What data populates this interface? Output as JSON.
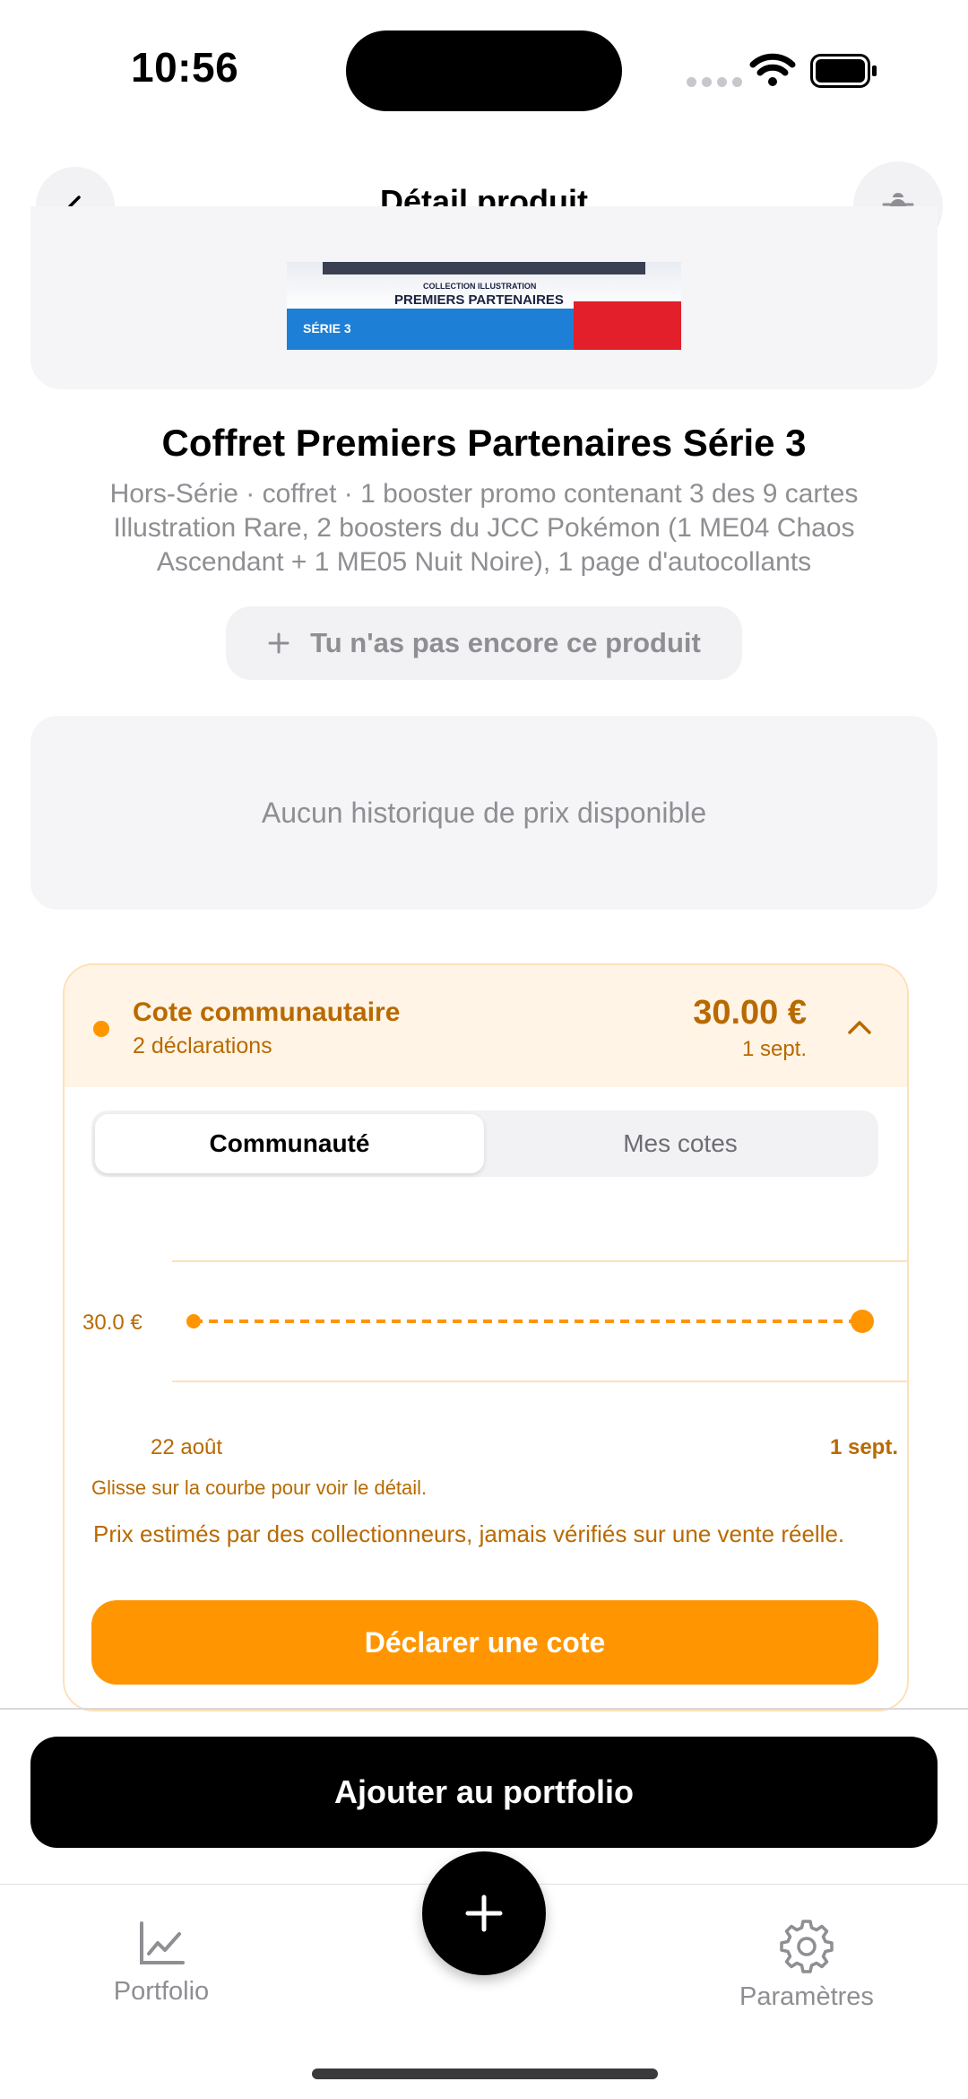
{
  "status_bar": {
    "time": "10:56"
  },
  "header": {
    "title": "Détail produit",
    "back_icon": "chevron-left-icon",
    "debug_icon": "bug-icon"
  },
  "product_image": {
    "collection": "COLLECTION ILLUSTRATION",
    "name": "PREMIERS PARTENAIRES",
    "serie": "SÉRIE 3"
  },
  "product": {
    "title": "Coffret Premiers Partenaires Série 3",
    "description": "Hors-Série · coffret · 1 booster promo contenant 3 des 9 cartes Illustration Rare, 2 boosters du JCC Pokémon (1 ME04 Chaos Ascendant + 1 ME05 Nuit Noire), 1 page d'autocollants",
    "ownership_label": "Tu n'as pas encore ce produit"
  },
  "price_history": {
    "empty_text": "Aucun historique de prix disponible"
  },
  "community_cote": {
    "title": "Cote communautaire",
    "declarations": "2 déclarations",
    "price": "30.00 €",
    "date": "1 sept.",
    "tabs": [
      "Communauté",
      "Mes cotes"
    ],
    "active_tab": "Communauté",
    "hint": "Glisse sur la courbe pour voir le détail.",
    "disclaimer": "Prix estimés par des collectionneurs, jamais vérifiés sur une vente réelle.",
    "declare_label": "Déclarer une cote",
    "accent_color": "#ff9500",
    "text_color": "#b86a00",
    "background_color": "#fff4e5"
  },
  "chart_data": {
    "type": "line",
    "x": [
      "22 août",
      "1 sept."
    ],
    "series": [
      {
        "values": [
          30.0,
          30.0
        ]
      }
    ],
    "y_tick_label": "30.0 €",
    "x_tick_labels": [
      "22 août",
      "1 sept."
    ]
  },
  "add_portfolio_label": "Ajouter au portfolio",
  "tab_bar": {
    "portfolio": {
      "label": "Portfolio",
      "icon": "chart-icon"
    },
    "add": {
      "icon": "plus-icon"
    },
    "settings": {
      "label": "Paramètres",
      "icon": "gear-icon"
    }
  }
}
